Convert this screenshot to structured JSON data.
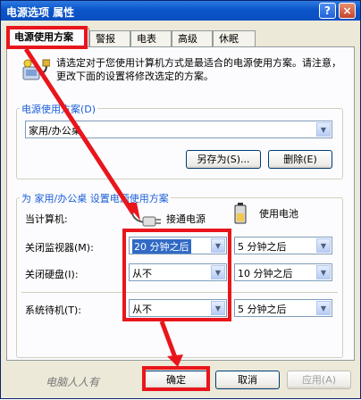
{
  "window": {
    "title": "电源选项 属性",
    "help_glyph": "?",
    "close_glyph": "×"
  },
  "tabs": [
    {
      "label": "电源使用方案"
    },
    {
      "label": "警报"
    },
    {
      "label": "电表"
    },
    {
      "label": "高级"
    },
    {
      "label": "休眠"
    }
  ],
  "intro_text": "请选定对于您使用计算机方式是最适合的电源使用方案。请注意，更改下面的设置将修改选定的方案。",
  "scheme_group": {
    "label": "电源使用方案(D)",
    "selected": "家用/办公桌",
    "save_as": "另存为(S)...",
    "delete": "删除(E)"
  },
  "settings_group": {
    "label": "为 家用/办公桌 设置电源使用方案",
    "when_computer": "当计算机:",
    "plugged_in": "接通电源",
    "on_battery": "使用电池",
    "rows": [
      {
        "label": "关闭监视器(M):",
        "ac": "20 分钟之后",
        "dc": "5 分钟之后"
      },
      {
        "label": "关闭硬盘(I):",
        "ac": "从不",
        "dc": "10 分钟之后"
      },
      {
        "label": "系统待机(T):",
        "ac": "从不",
        "dc": "5 分钟之后"
      }
    ]
  },
  "footer": {
    "watermark": "电脑人人有",
    "ok": "确定",
    "cancel": "取消",
    "apply": "应用(A)"
  },
  "colors": {
    "accent_red": "#E8161C",
    "title_blue": "#0A55C9",
    "group_blue": "#1B5ED6"
  }
}
